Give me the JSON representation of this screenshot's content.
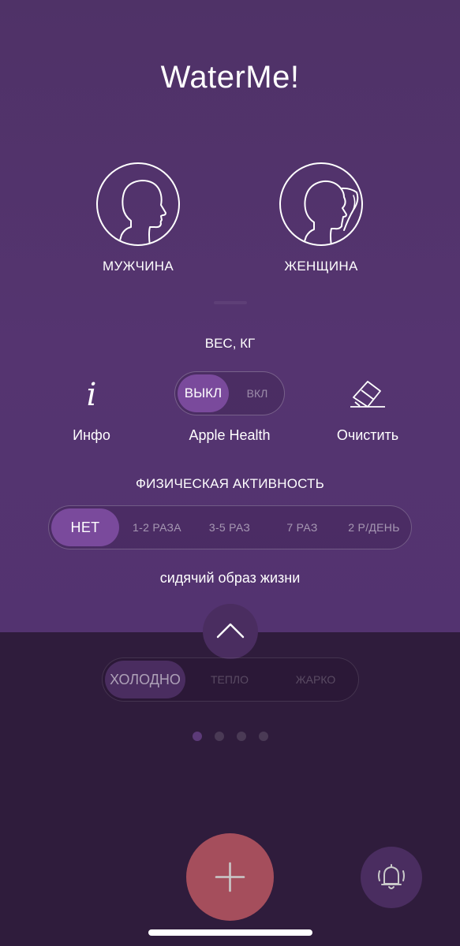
{
  "app": {
    "title": "WaterMe!"
  },
  "gender": {
    "male_label": "МУЖЧИНА",
    "female_label": "ЖЕНЩИНА",
    "male_icon": "male-profile-icon",
    "female_icon": "female-profile-icon"
  },
  "weight": {
    "label": "ВЕС, КГ"
  },
  "controls": {
    "info_icon": "info-icon",
    "info_glyph": "i",
    "info_label": "Инфо",
    "health_label": "Apple Health",
    "health_off": "ВЫКЛ",
    "health_on": "ВКЛ",
    "health_selected": "ВЫКЛ",
    "clear_icon": "eraser-icon",
    "clear_label": "Очистить"
  },
  "activity": {
    "title": "ФИЗИЧЕСКАЯ АКТИВНОСТЬ",
    "options": [
      "НЕТ",
      "1-2 РАЗА",
      "3-5 РАЗ",
      "7 РАЗ",
      "2 Р/ДЕНЬ"
    ],
    "selected": "НЕТ",
    "description": "сидячий образ жизни"
  },
  "climate": {
    "options": [
      "ХОЛОДНО",
      "ТЕПЛО",
      "ЖАРКО"
    ],
    "selected": "ХОЛОДНО"
  },
  "pager": {
    "count": 4,
    "active_index": 0
  },
  "actions": {
    "collapse_icon": "chevron-up-icon",
    "add_icon": "plus-icon",
    "reminder_icon": "bell-ringing-icon"
  },
  "colors": {
    "top_panel": "#553470",
    "bottom_panel": "#2f1c3c",
    "accent_segment": "#7a4a9c",
    "add_button": "#a54e5c",
    "round_button": "#4a2d60"
  }
}
